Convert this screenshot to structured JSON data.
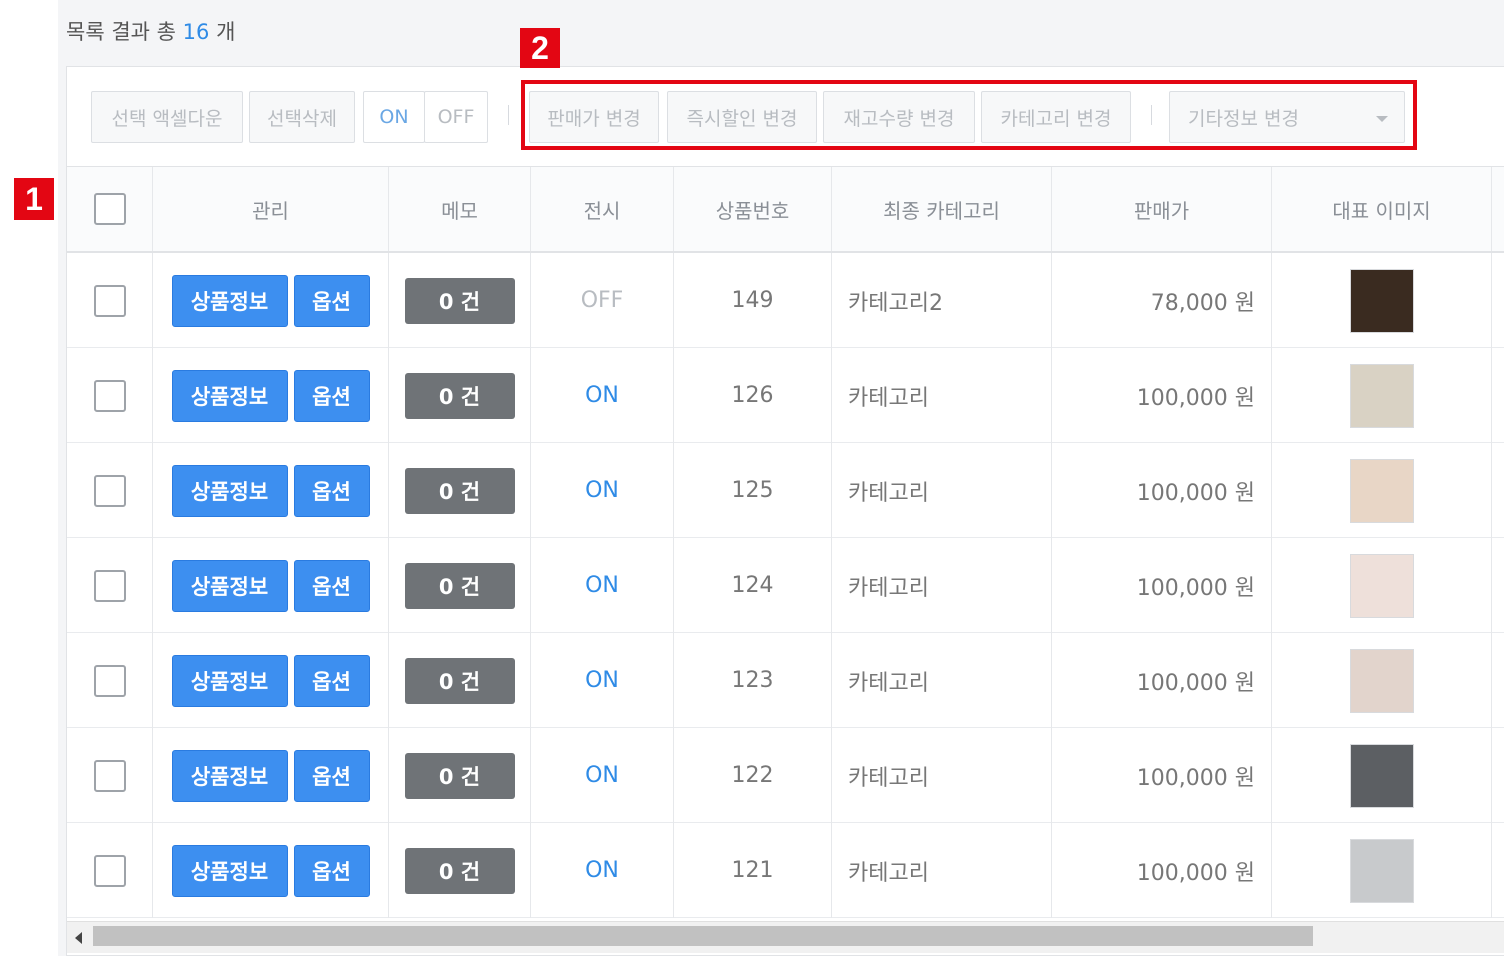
{
  "header": {
    "result_prefix": "목록 결과 총",
    "result_count": "16",
    "result_suffix": "개"
  },
  "markers": [
    "1",
    "2"
  ],
  "toolbar": {
    "excel_download": "선택 액셀다운",
    "delete_selected": "선택삭제",
    "on": "ON",
    "off": "OFF",
    "price_change": "판매가 변경",
    "instant_discount": "즉시할인 변경",
    "stock_change": "재고수량 변경",
    "category_change": "카테고리 변경",
    "other_info_change": "기타정보 변경"
  },
  "table": {
    "columns": [
      "관리",
      "메모",
      "전시",
      "상품번호",
      "최종 카테고리",
      "판매가",
      "대표 이미지"
    ],
    "buttons": {
      "product_info": "상품정보",
      "option": "옵션"
    },
    "rows": [
      {
        "memo": "0 건",
        "display": "OFF",
        "product_no": "149",
        "category": "카테고리2",
        "price": "78,000 원",
        "thumb_color": "#3a2b20"
      },
      {
        "memo": "0 건",
        "display": "ON",
        "product_no": "126",
        "category": "카테고리",
        "price": "100,000 원",
        "thumb_color": "#d9d2c4"
      },
      {
        "memo": "0 건",
        "display": "ON",
        "product_no": "125",
        "category": "카테고리",
        "price": "100,000 원",
        "thumb_color": "#e8d6c6"
      },
      {
        "memo": "0 건",
        "display": "ON",
        "product_no": "124",
        "category": "카테고리",
        "price": "100,000 원",
        "thumb_color": "#eee0da"
      },
      {
        "memo": "0 건",
        "display": "ON",
        "product_no": "123",
        "category": "카테고리",
        "price": "100,000 원",
        "thumb_color": "#e2d4cc"
      },
      {
        "memo": "0 건",
        "display": "ON",
        "product_no": "122",
        "category": "카테고리",
        "price": "100,000 원",
        "thumb_color": "#5c5f63"
      },
      {
        "memo": "0 건",
        "display": "ON",
        "product_no": "121",
        "category": "카테고리",
        "price": "100,000 원",
        "thumb_color": "#c8cacc"
      }
    ]
  }
}
